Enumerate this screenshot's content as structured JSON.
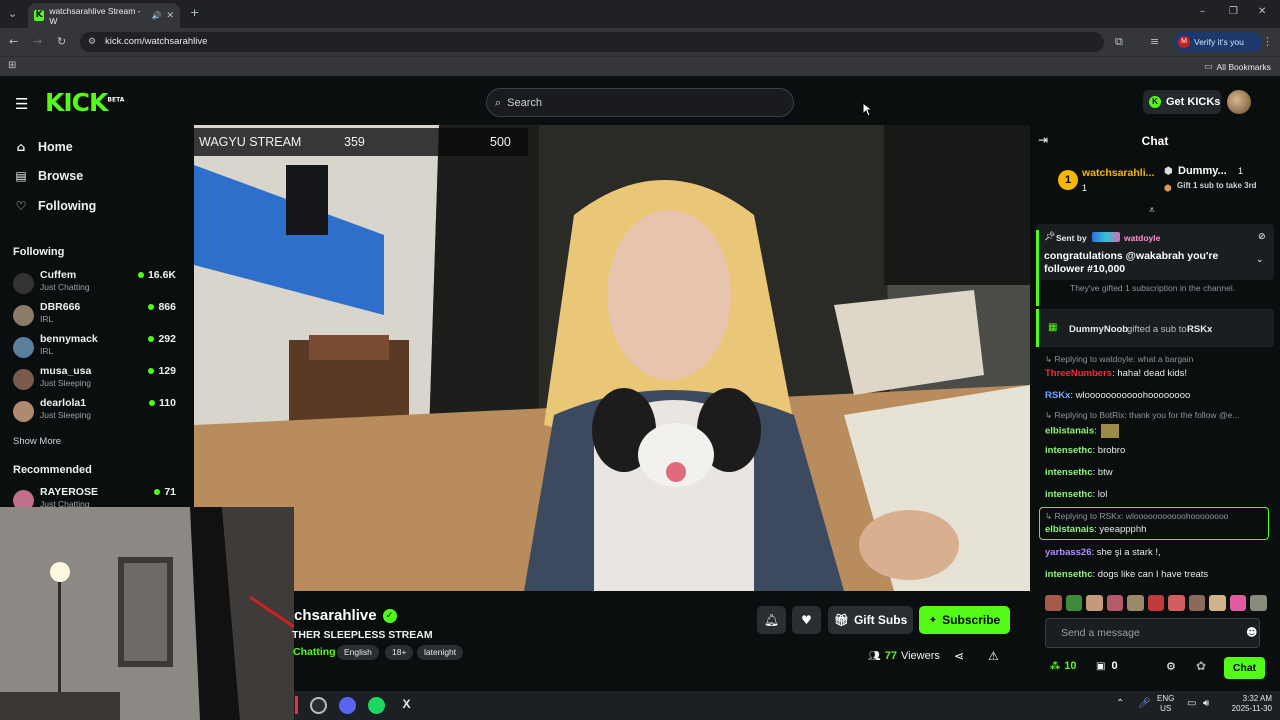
{
  "browser": {
    "tab_title": "watchsarahlive Stream - W",
    "url": "kick.com/watchsarahlive",
    "verify_label": "Verify it's you",
    "all_bookmarks": "All Bookmarks"
  },
  "header": {
    "logo": "KICK",
    "logo_badge": "BETA",
    "search_placeholder": "Search",
    "get_kicks": "Get KICKs"
  },
  "nav": {
    "items": [
      {
        "label": "Home",
        "icon": "home-icon"
      },
      {
        "label": "Browse",
        "icon": "browse-icon"
      },
      {
        "label": "Following",
        "icon": "heart-icon"
      }
    ],
    "following_heading": "Following",
    "following": [
      {
        "name": "Cuffem",
        "category": "Just Chatting",
        "viewers": "16.6K"
      },
      {
        "name": "DBR666",
        "category": "IRL",
        "viewers": "866"
      },
      {
        "name": "bennymack",
        "category": "IRL",
        "viewers": "292"
      },
      {
        "name": "musa_usa",
        "category": "Just Sleeping",
        "viewers": "129"
      },
      {
        "name": "dearlola1",
        "category": "Just Sleeping",
        "viewers": "110"
      }
    ],
    "show_more": "Show More",
    "recommended_heading": "Recommended",
    "recommended": [
      {
        "name": "RAYEROSE",
        "category": "Just Chatting",
        "viewers": "71"
      }
    ]
  },
  "video": {
    "overlay_title": "WAGYU STREAM",
    "overlay_current": "359",
    "overlay_goal": "500"
  },
  "stream": {
    "channel_name": "chsarahlive",
    "title": "THER SLEEPLESS STREAM",
    "category": "Chatting",
    "tags": [
      "English",
      "18+",
      "latenight"
    ],
    "gift_subs": "Gift Subs",
    "subscribe": "Subscribe",
    "viewers_count": "77",
    "viewers_label": "Viewers"
  },
  "chat": {
    "title": "Chat",
    "leaderboard": {
      "first_name": "watchsarahli...",
      "first_count": "1",
      "second_name": "Dummy...",
      "second_count": "1",
      "gift_hint": "Gift 1 sub to take 3rd"
    },
    "pinned": {
      "sent_by": "Sent by",
      "sender": "watdoyle",
      "text": "congratulations @wakabrah you're follower #10,000"
    },
    "gift_subtext": "They've gifted 1 subscription in the channel.",
    "gift_user": "DummyNoob",
    "gift_action": "gifted a sub to",
    "gift_target": "RSKx",
    "messages": [
      {
        "reply": "Replying to watdoyle: what a bargain",
        "user": "ThreeNumbers",
        "text": ": haha! dead kids!"
      },
      {
        "user": "RSKx",
        "text": ": wlooooooooooohoooooooo"
      },
      {
        "reply": "Replying to BotRix: thank you for the follow @e...",
        "user": "elbistanais",
        "text": ":"
      },
      {
        "user": "intensethc",
        "text": ": brobro"
      },
      {
        "user": "intensethc",
        "text": ": btw"
      },
      {
        "user": "intensethc",
        "text": ": lol"
      },
      {
        "reply": "Replying to RSKx: wlooooooooooohoooooooo",
        "user": "elbistanais",
        "text": ": yeeappphh"
      },
      {
        "user": "yarbass26",
        "text": ": she şi a stark !,"
      },
      {
        "user": "intensethc",
        "text": ": dogs like can I have treats"
      }
    ],
    "send_placeholder": "Send a message",
    "kicks_count": "10",
    "gift_count": "0",
    "chat_button": "Chat"
  },
  "taskbar": {
    "lang_top": "ENG",
    "lang_bottom": "US",
    "time": "3:32 AM",
    "date": "2025-11-30"
  },
  "colors": {
    "kick_green": "#53fc18",
    "background": "#0b0e0f",
    "username_red": "#e8313a",
    "username_blue": "#6fa8ff",
    "username_green": "#8ef57a",
    "username_purple": "#b38cff"
  }
}
